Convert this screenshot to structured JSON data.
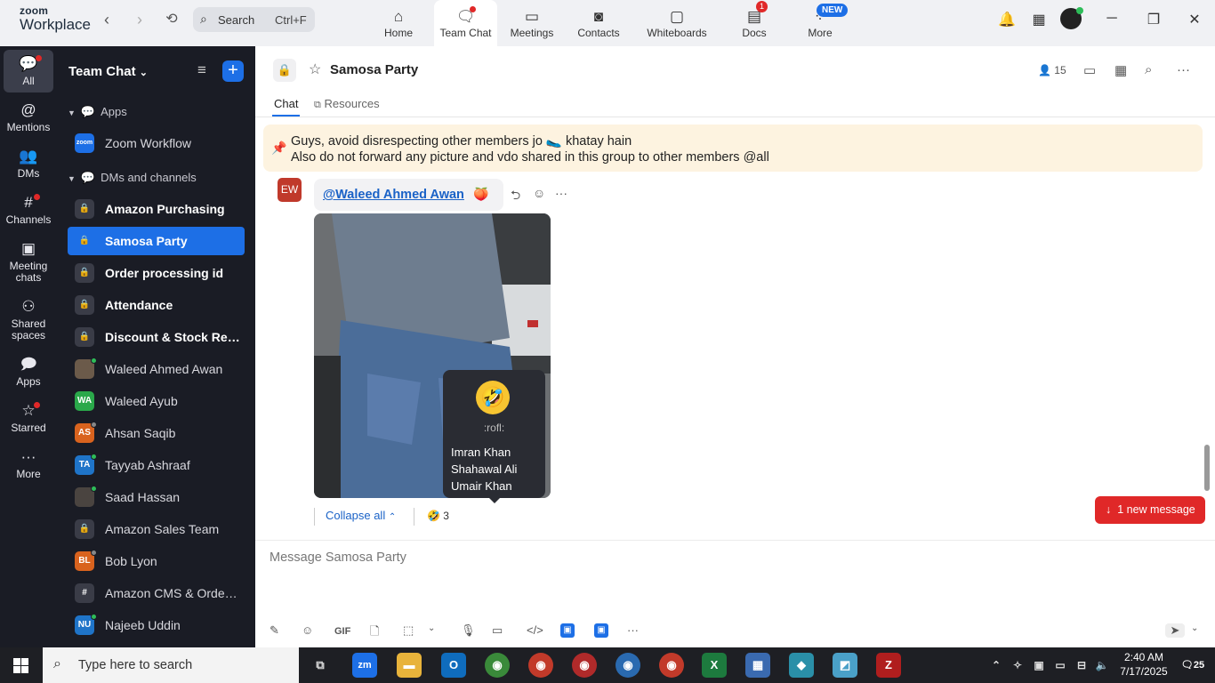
{
  "app": {
    "logo_line1": "zoom",
    "logo_line2": "Workplace"
  },
  "search": {
    "label": "Search",
    "shortcut": "Ctrl+F"
  },
  "top_tabs": [
    {
      "label": "Home"
    },
    {
      "label": "Team Chat"
    },
    {
      "label": "Meetings"
    },
    {
      "label": "Contacts"
    },
    {
      "label": "Whiteboards"
    },
    {
      "label": "Docs",
      "badge": "1"
    },
    {
      "label": "More",
      "badge": "NEW"
    }
  ],
  "rail": [
    {
      "label": "All"
    },
    {
      "label": "Mentions"
    },
    {
      "label": "DMs"
    },
    {
      "label": "Channels"
    },
    {
      "label": "Meeting chats"
    },
    {
      "label": "Shared spaces"
    },
    {
      "label": "Apps"
    },
    {
      "label": "Starred"
    },
    {
      "label": "More"
    }
  ],
  "sidebar": {
    "title": "Team Chat",
    "sections": {
      "apps": "Apps",
      "dms": "DMs and channels"
    },
    "app_items": [
      {
        "label": "Zoom Workflow",
        "icon_text": "zoom"
      }
    ],
    "items": [
      {
        "label": "Amazon Purchasing"
      },
      {
        "label": "Samosa Party"
      },
      {
        "label": "Order processing id"
      },
      {
        "label": "Attendance"
      },
      {
        "label": "Discount & Stock Res..."
      },
      {
        "label": "Waleed Ahmed Awan"
      },
      {
        "label": "Waleed Ayub",
        "initials": "WA"
      },
      {
        "label": "Ahsan Saqib",
        "initials": "AS"
      },
      {
        "label": "Tayyab Ashraaf",
        "initials": "TA"
      },
      {
        "label": "Saad Hassan"
      },
      {
        "label": "Amazon Sales Team"
      },
      {
        "label": "Bob Lyon",
        "initials": "BL"
      },
      {
        "label": "Amazon CMS & OrderA..."
      },
      {
        "label": "Najeeb Uddin",
        "initials": "NU"
      }
    ]
  },
  "channel": {
    "name": "Samosa Party",
    "member_count": "15",
    "tabs": {
      "chat": "Chat",
      "resources": "Resources"
    }
  },
  "pinned": {
    "line1": "Guys, avoid disrespecting other members jo 🥿 khatay hain",
    "line2": "Also do not forward any picture and vdo shared in this group to other members @all"
  },
  "message": {
    "avatar_initials": "EW",
    "mention": "@Waleed Ahmed Awan",
    "emoji": "🍑"
  },
  "reaction_tooltip": {
    "emoji": "🤣",
    "code": ":rofl:",
    "users": [
      "Imran Khan",
      "Shahawal Ali",
      "Umair Khan"
    ]
  },
  "reactions": {
    "collapse_label": "Collapse all",
    "emoji": "🤣",
    "count": "3"
  },
  "new_message_btn": "1 new message",
  "composer": {
    "placeholder": "Message Samosa Party",
    "gif_label": "GIF"
  },
  "taskbar": {
    "search_placeholder": "Type here to search",
    "time": "2:40 AM",
    "date": "7/17/2025",
    "notif_count": "25"
  },
  "colors": {
    "accent": "#1d6fe6",
    "sidebar_bg": "#1a1c25",
    "alert": "#e02828",
    "pinned_bg": "#fdf3e0"
  }
}
